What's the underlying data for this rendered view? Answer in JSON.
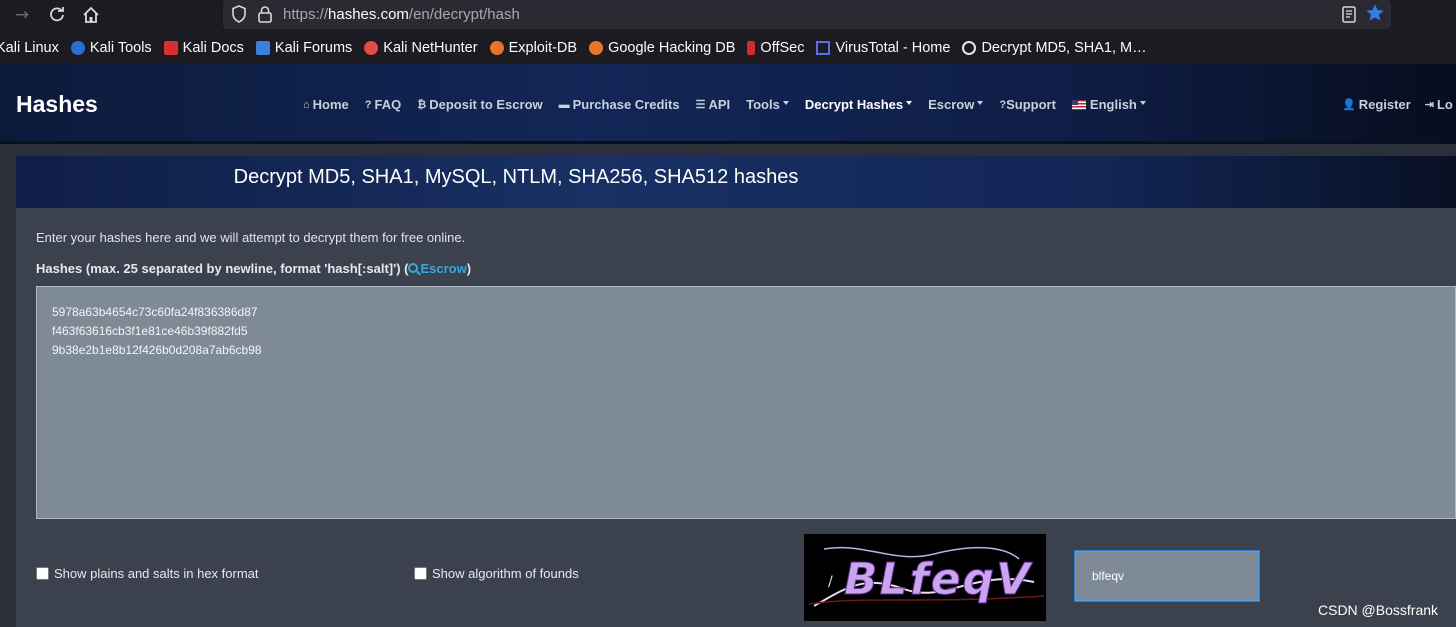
{
  "browser": {
    "url_scheme": "https://",
    "url_host": "hashes.com",
    "url_path": "/en/decrypt/hash",
    "bookmarks": [
      {
        "label": "Kali Linux",
        "icon": "kali-icon"
      },
      {
        "label": "Kali Tools",
        "icon": "kali-tools-icon"
      },
      {
        "label": "Kali Docs",
        "icon": "kali-docs-icon"
      },
      {
        "label": "Kali Forums",
        "icon": "kali-forums-icon"
      },
      {
        "label": "Kali NetHunter",
        "icon": "nethunter-icon"
      },
      {
        "label": "Exploit-DB",
        "icon": "exploit-db-icon"
      },
      {
        "label": "Google Hacking DB",
        "icon": "ghdb-icon"
      },
      {
        "label": "OffSec",
        "icon": "offsec-icon"
      },
      {
        "label": "VirusTotal - Home",
        "icon": "virustotal-icon"
      },
      {
        "label": "Decrypt MD5, SHA1, M…",
        "icon": "hashes-icon"
      }
    ]
  },
  "site": {
    "brand": "Hashes",
    "menu": {
      "home": "Home",
      "faq": "FAQ",
      "deposit": "Deposit to Escrow",
      "purchase": "Purchase Credits",
      "api": "API",
      "tools": "Tools",
      "decrypt": "Decrypt Hashes",
      "escrow": "Escrow",
      "support": "Support",
      "language": "English"
    },
    "auth": {
      "register": "Register",
      "login": "Lo"
    }
  },
  "card": {
    "title": "Decrypt MD5, SHA1, MySQL, NTLM, SHA256, SHA512 hashes",
    "intro": "Enter your hashes here and we will attempt to decrypt them for free online.",
    "hash_label": "Hashes (max. 25 separated by newline, format 'hash[:salt]') (",
    "escrow_link": "Escrow",
    "hash_label_end": ")",
    "hashes_value": "5978a63b4654c73c60fa24f836386d87\nf463f63616cb3f1e81ce46b39f882fd5\n9b38e2b1e8b12f426b0d208a7ab6cb98",
    "check_hex": "Show plains and salts in hex format",
    "check_algo": "Show algorithm of founds",
    "captcha_text": "BLfeqV",
    "captcha_value": "blfeqv"
  },
  "watermark": "CSDN @Bossfrank",
  "colors": {
    "accent": "#39a7e0",
    "header_dark": "#0c1a3a",
    "card_bg": "#3b414d",
    "textarea_bg": "#7e8a95",
    "star": "#2f7fe8"
  }
}
